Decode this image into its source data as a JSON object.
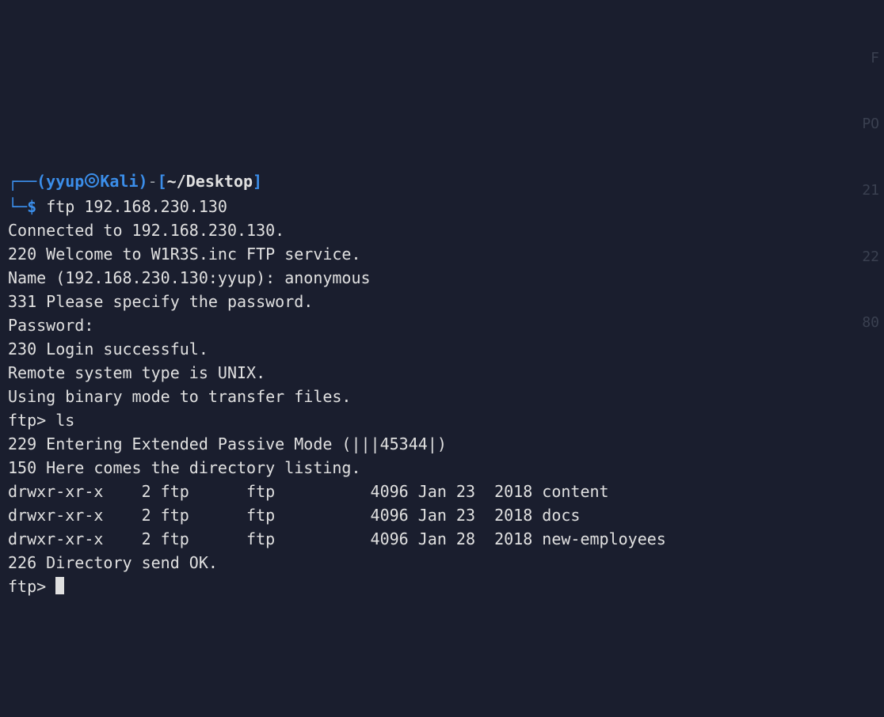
{
  "prompt": {
    "box_tl": "┌──",
    "paren_open": "(",
    "user": "yyup",
    "at_icon": "at-circle-icon",
    "host": "Kali",
    "paren_close": ")",
    "dash": "-",
    "brack_open": "[",
    "path": "~/Desktop",
    "brack_close": "]",
    "box_bl": "└─",
    "dollar": "$",
    "command": "ftp 192.168.230.130"
  },
  "session": {
    "l0": "Connected to 192.168.230.130.",
    "l1": "220 Welcome to W1R3S.inc FTP service.",
    "l2": "Name (192.168.230.130:yyup): anonymous",
    "l3": "331 Please specify the password.",
    "l4": "Password:",
    "l5": "230 Login successful.",
    "l6": "Remote system type is UNIX.",
    "l7": "Using binary mode to transfer files.",
    "l8": "ftp> ls",
    "l9": "229 Entering Extended Passive Mode (|||45344|)",
    "l10": "150 Here comes the directory listing.",
    "l11": "drwxr-xr-x    2 ftp      ftp          4096 Jan 23  2018 content",
    "l12": "drwxr-xr-x    2 ftp      ftp          4096 Jan 23  2018 docs",
    "l13": "drwxr-xr-x    2 ftp      ftp          4096 Jan 28  2018 new-employees",
    "l14": "226 Directory send OK.",
    "l15": "ftp> "
  },
  "ghost": {
    "g0": "F",
    "g1": "PO",
    "g2": "21",
    "g3": "22",
    "g4": "80"
  }
}
